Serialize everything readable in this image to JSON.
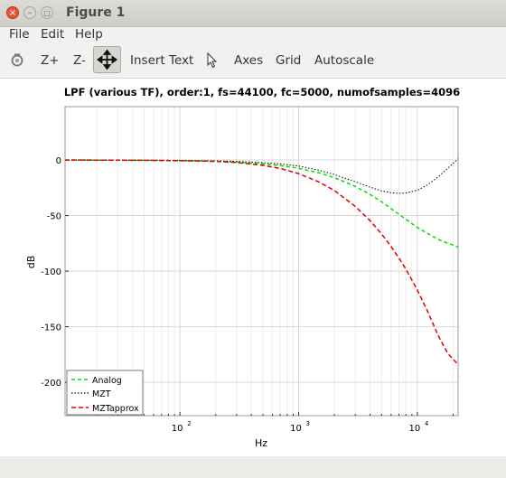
{
  "window": {
    "title": "Figure 1",
    "close_glyph": "×",
    "min_glyph": "–",
    "max_glyph": "□"
  },
  "menu": {
    "file": "File",
    "edit": "Edit",
    "help": "Help"
  },
  "toolbar": {
    "zoom_in": "Z+",
    "zoom_out": "Z-",
    "insert_text": "Insert Text",
    "axes": "Axes",
    "grid": "Grid",
    "autoscale": "Autoscale"
  },
  "chart_data": {
    "type": "line",
    "title": "LPF (various TF), order:1, fs=44100, fc=5000, numofsamples=4096",
    "xlabel": "Hz",
    "ylabel": "dB",
    "xscale": "log",
    "xlim": [
      10.77,
      22050
    ],
    "ylim": [
      -230,
      48
    ],
    "yticks": [
      0,
      -50,
      -100,
      -150,
      -200
    ],
    "xticks": [
      {
        "value": 100,
        "base": "10",
        "exp": "2"
      },
      {
        "value": 1000,
        "base": "10",
        "exp": "3"
      },
      {
        "value": 10000,
        "base": "10",
        "exp": "4"
      }
    ],
    "grid": true,
    "legend_position": "bottom-left",
    "series": [
      {
        "name": "Analog",
        "color": "#00e000",
        "dash": "4,3",
        "x": [
          10.77,
          20,
          50,
          100,
          200,
          300,
          500,
          700,
          1000,
          1500,
          2000,
          3000,
          4000,
          5000,
          7000,
          10000,
          15000,
          22050
        ],
        "y": [
          0,
          -0.1,
          -0.3,
          -0.5,
          -1.2,
          -1.9,
          -3.5,
          -5,
          -7.4,
          -11.7,
          -15.9,
          -23.8,
          -31,
          -37.6,
          -48.8,
          -60.8,
          -71.5,
          -78.4
        ]
      },
      {
        "name": "MZT",
        "color": "#000000",
        "dash": "1.5,2",
        "x": [
          10.77,
          20,
          50,
          100,
          200,
          300,
          500,
          700,
          1000,
          1500,
          2000,
          3000,
          4000,
          5000,
          6000,
          7000,
          8000,
          10000,
          12000,
          15000,
          18000,
          22050
        ],
        "y": [
          0,
          -0.1,
          -0.2,
          -0.4,
          -0.8,
          -1.3,
          -2.4,
          -3.5,
          -5.5,
          -9.3,
          -13.1,
          -19.6,
          -24.5,
          -27.8,
          -29.5,
          -30,
          -29.7,
          -27.3,
          -22.8,
          -15.2,
          -7.5,
          1
        ]
      },
      {
        "name": "MZTapprox",
        "color": "#e00000",
        "dash": "5,3",
        "x": [
          10.77,
          20,
          50,
          100,
          200,
          300,
          500,
          700,
          1000,
          1500,
          2000,
          3000,
          4000,
          5000,
          6000,
          7000,
          8000,
          10000,
          12000,
          15000,
          18000,
          22050
        ],
        "y": [
          0,
          -0.1,
          -0.3,
          -0.6,
          -1.3,
          -2.2,
          -4.8,
          -7.6,
          -12.2,
          -20,
          -27.5,
          -41.7,
          -54.6,
          -66.5,
          -77.7,
          -88.2,
          -98.2,
          -117,
          -134.6,
          -158,
          -173.8,
          -184
        ]
      }
    ]
  }
}
